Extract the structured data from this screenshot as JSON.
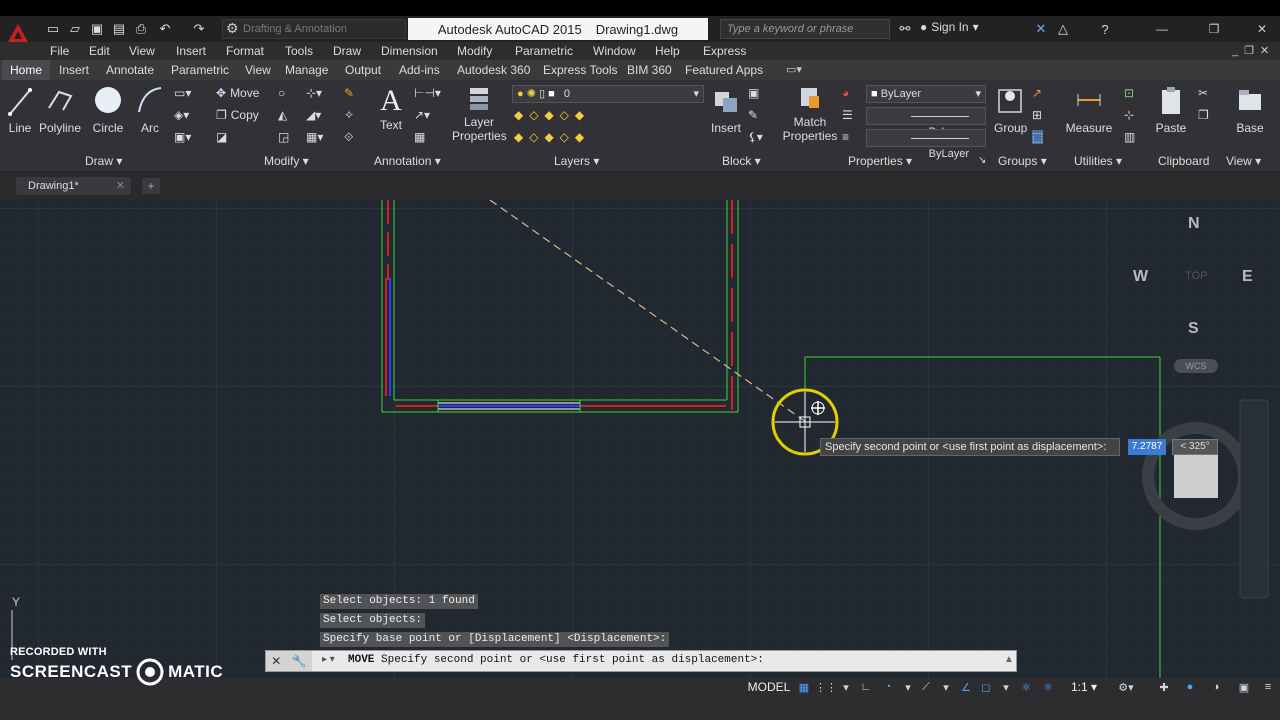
{
  "app": {
    "title_app": "Autodesk AutoCAD 2015",
    "title_file": "Drawing1.dwg",
    "workspace": "Drafting & Annotation",
    "search_placeholder": "Type a keyword or phrase",
    "sign_in": "Sign In"
  },
  "menu": [
    "File",
    "Edit",
    "View",
    "Insert",
    "Format",
    "Tools",
    "Draw",
    "Dimension",
    "Modify",
    "Parametric",
    "Window",
    "Help",
    "Express"
  ],
  "ribbon_tabs": [
    "Home",
    "Insert",
    "Annotate",
    "Parametric",
    "View",
    "Manage",
    "Output",
    "Add-ins",
    "Autodesk 360",
    "Express Tools",
    "BIM 360",
    "Featured Apps"
  ],
  "active_tab": "Home",
  "ribbon": {
    "draw": {
      "line": "Line",
      "polyline": "Polyline",
      "circle": "Circle",
      "arc": "Arc",
      "panel": "Draw"
    },
    "modify": {
      "move": "Move",
      "copy": "Copy",
      "panel": "Modify"
    },
    "annotation": {
      "text": "Text",
      "panel": "Annotation"
    },
    "layers": {
      "layer_properties_1": "Layer",
      "layer_properties_2": "Properties",
      "current_layer": "0",
      "panel": "Layers"
    },
    "block": {
      "insert": "Insert",
      "panel": "Block"
    },
    "properties": {
      "match_1": "Match",
      "match_2": "Properties",
      "color": "ByLayer",
      "linetype": "ByLayer",
      "lineweight": "ByLayer",
      "panel": "Properties"
    },
    "groups": {
      "group": "Group",
      "panel": "Groups"
    },
    "utilities": {
      "measure": "Measure",
      "panel": "Utilities"
    },
    "clipboard": {
      "paste": "Paste",
      "panel": "Clipboard"
    },
    "view": {
      "base": "Base",
      "panel": "View"
    }
  },
  "doc_tab": "Drawing1*",
  "viewcube": {
    "n": "N",
    "s": "S",
    "e": "E",
    "w": "W",
    "top": "TOP",
    "wcs": "WCS"
  },
  "ucs_y": "Y",
  "tooltip": {
    "prompt": "Specify second point or <use first point as displacement>:",
    "distance": "7.2787",
    "angle": "< 325°"
  },
  "history": [
    "Select objects: 1 found",
    "Select objects:",
    "Specify base point or [Displacement] <Displacement>:"
  ],
  "command_line": {
    "command": "MOVE",
    "text": "Specify second point or <use first point as displacement>:"
  },
  "status": {
    "model": "MODEL",
    "scale": "1:1"
  },
  "watermark": {
    "line1": "RECORDED WITH",
    "line2a": "SCREENCAST",
    "line2b": "MATIC"
  }
}
